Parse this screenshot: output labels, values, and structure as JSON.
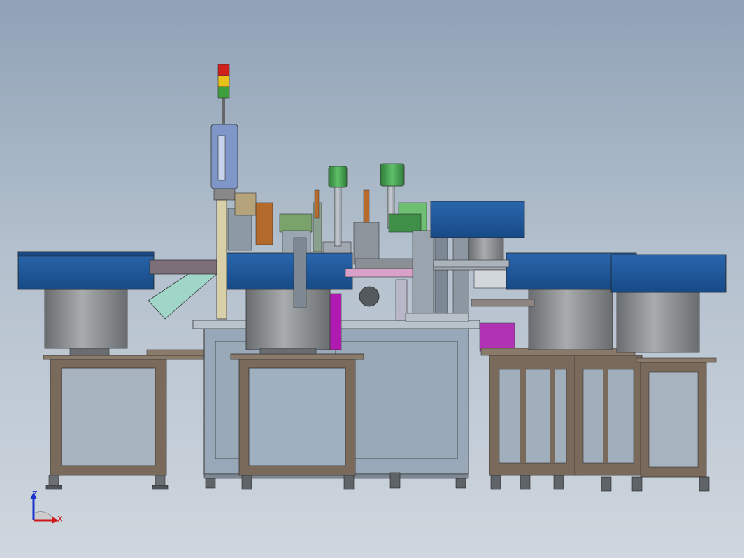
{
  "viewport": {
    "background_top": "#8fa2b6",
    "background_bottom": "#cfd6de"
  },
  "model": {
    "bowl_color": "#1f5597",
    "bowl_dark": "#163f73",
    "drum_color": "#8a8d90",
    "frame_color": "#7a6a5c",
    "cabinet_color": "#98a8b8",
    "magenta": "#b01ab0",
    "green_part": "#3f9a4a",
    "mint": "#9fd6c8"
  },
  "triad": {
    "z_label": "Z",
    "x_label": "X",
    "z_color": "#1a33cc",
    "x_color": "#cc1a1a"
  }
}
